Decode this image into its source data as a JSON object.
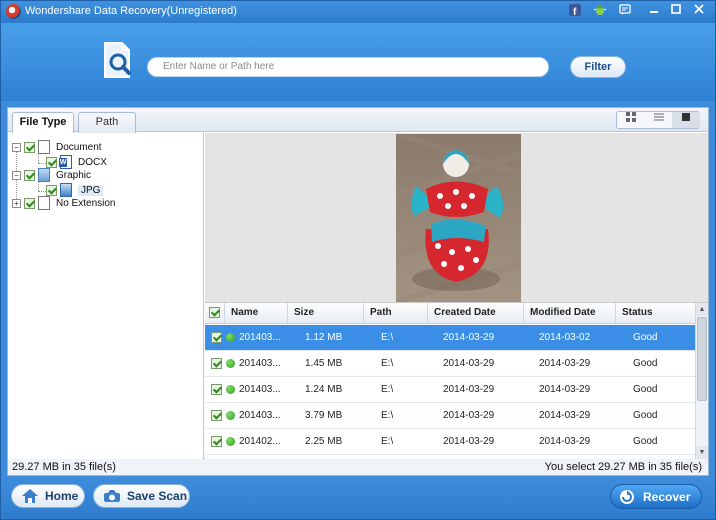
{
  "window": {
    "title": "Wondershare Data Recovery(Unregistered)",
    "titlebar_icons": [
      "facebook-icon",
      "bug-icon",
      "chat-icon",
      "minimize-icon",
      "maximize-icon",
      "close-icon"
    ]
  },
  "search": {
    "placeholder": "Enter Name or Path here",
    "filter_label": "Filter"
  },
  "tabs": [
    {
      "label": "File Type",
      "active": true
    },
    {
      "label": "Path",
      "active": false
    }
  ],
  "view_modes": [
    "thumbnail-view-icon",
    "list-view-icon",
    "preview-view-icon"
  ],
  "tree": [
    {
      "label": "Document",
      "icon": "document-icon",
      "level": 0,
      "checked": true,
      "expanded": true
    },
    {
      "label": "DOCX",
      "icon": "word-file-icon",
      "level": 1,
      "checked": true
    },
    {
      "label": "Graphic",
      "icon": "image-file-icon",
      "level": 0,
      "checked": true,
      "expanded": true
    },
    {
      "label": "JPG",
      "icon": "jpg-file-icon",
      "level": 1,
      "checked": true,
      "selected": true
    },
    {
      "label": "No Extension",
      "icon": "blank-file-icon",
      "level": 0,
      "checked": true,
      "expanded": false
    }
  ],
  "table": {
    "headers": [
      "Name",
      "Size",
      "Path",
      "Created Date",
      "Modified Date",
      "Status"
    ],
    "rows": [
      {
        "name": "201403...",
        "size": "1.12 MB",
        "path": "E:\\",
        "created": "2014-03-29",
        "modified": "2014-03-02",
        "status": "Good",
        "selected": true
      },
      {
        "name": "201403...",
        "size": "1.45 MB",
        "path": "E:\\",
        "created": "2014-03-29",
        "modified": "2014-03-29",
        "status": "Good"
      },
      {
        "name": "201403...",
        "size": "1.24 MB",
        "path": "E:\\",
        "created": "2014-03-29",
        "modified": "2014-03-29",
        "status": "Good"
      },
      {
        "name": "201403...",
        "size": "3.79 MB",
        "path": "E:\\",
        "created": "2014-03-29",
        "modified": "2014-03-29",
        "status": "Good"
      },
      {
        "name": "201402...",
        "size": "2.25 MB",
        "path": "E:\\",
        "created": "2014-03-29",
        "modified": "2014-03-29",
        "status": "Good"
      }
    ]
  },
  "status": {
    "left": "29.27 MB in 35 file(s)",
    "right": "You select 29.27 MB in 35 file(s)"
  },
  "buttons": {
    "home": "Home",
    "save_scan": "Save Scan",
    "recover": "Recover"
  },
  "colors": {
    "accent": "#3a8ee6",
    "titlebar": "#2d7ccc",
    "status_good_dot": "#2f9a1d"
  }
}
